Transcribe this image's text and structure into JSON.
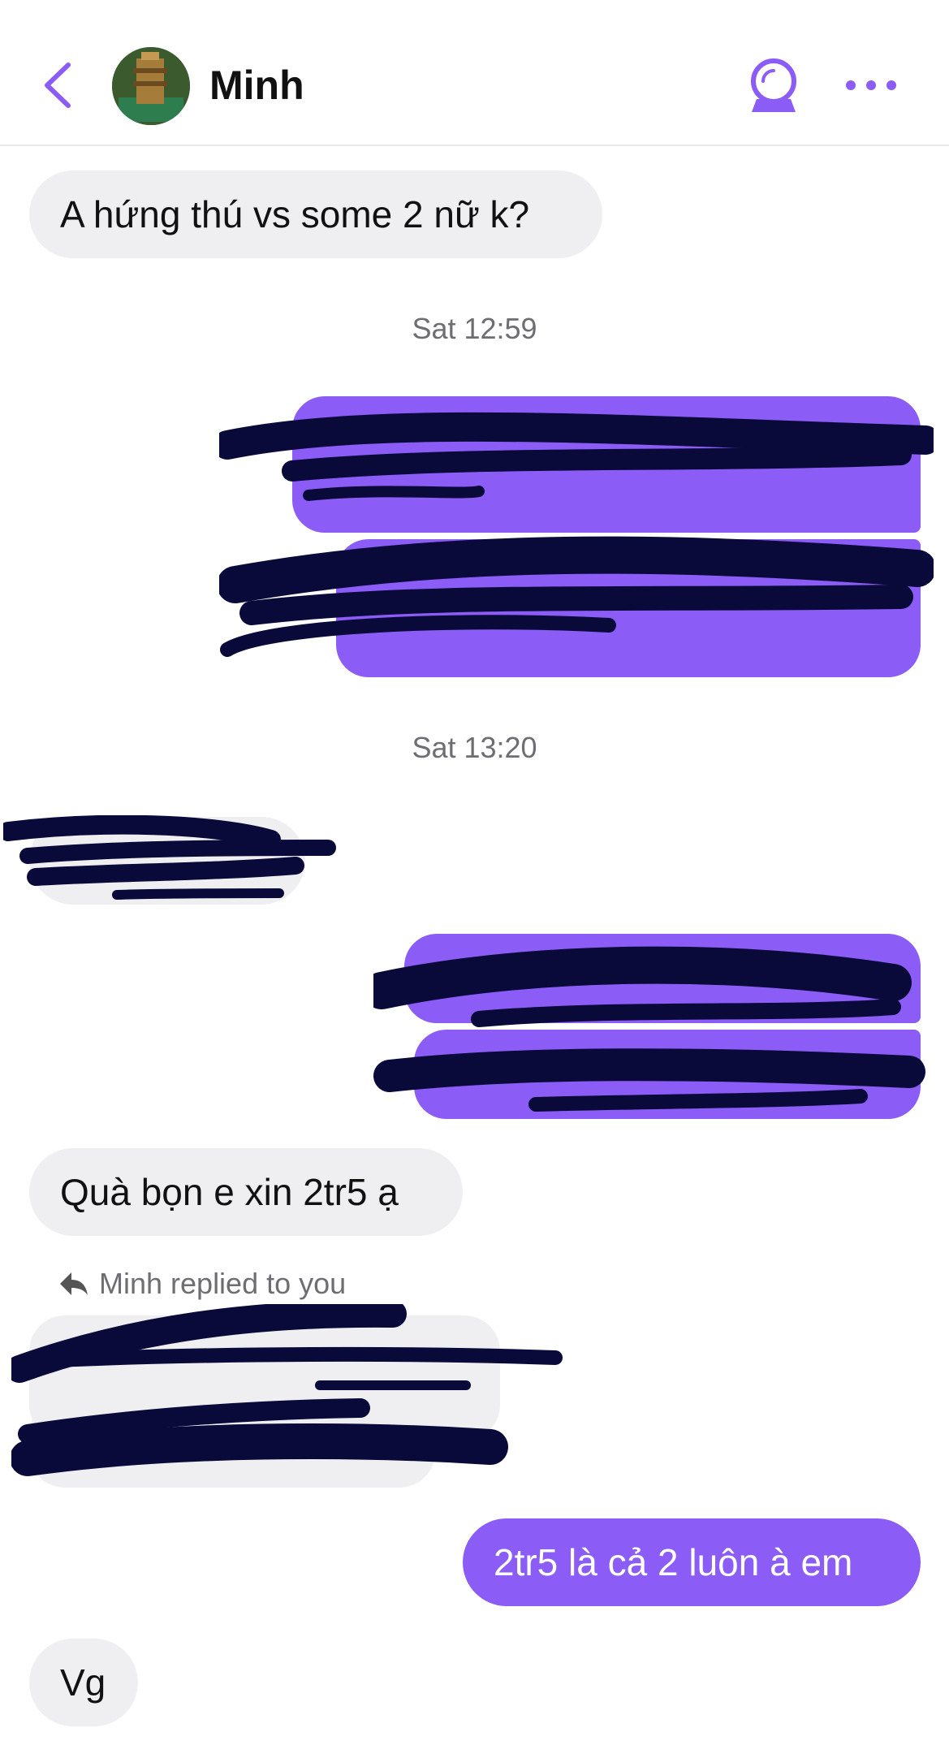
{
  "header": {
    "contact_name": "Minh",
    "icons": {
      "back": "chevron-left-icon",
      "theme": "crystal-ball-icon",
      "more": "more-horizontal-icon"
    }
  },
  "colors": {
    "accent": "#8b5cf6",
    "incoming_bubble": "#efeff1",
    "redaction": "#0a0a3a"
  },
  "messages": {
    "m1": "A hứng thú vs some 2 nữ k?",
    "ts1": "Sat 12:59",
    "ts2": "Sat 13:20",
    "m_qua": "Quà bọn e xin 2tr5 ạ",
    "reply_label": "Minh replied to you",
    "m_out_last": "2tr5 là cả 2 luôn à em",
    "m_last": "Vg"
  }
}
